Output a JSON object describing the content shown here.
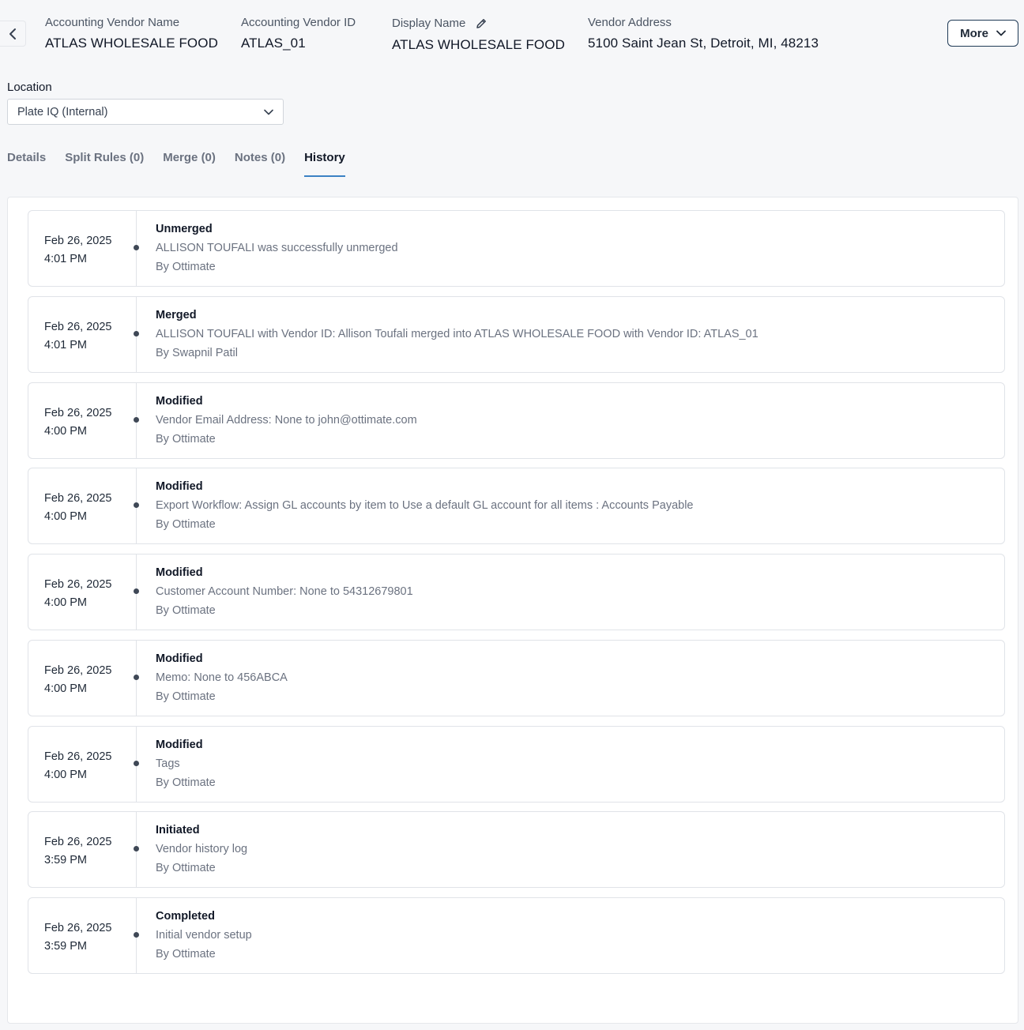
{
  "header": {
    "vendor_name_label": "Accounting Vendor Name",
    "vendor_name": "ATLAS WHOLESALE FOOD",
    "vendor_id_label": "Accounting Vendor ID",
    "vendor_id": "ATLAS_01",
    "display_name_label": "Display Name",
    "display_name": "ATLAS WHOLESALE FOOD",
    "address_label": "Vendor Address",
    "address": "5100 Saint Jean St, Detroit, MI, 48213",
    "more_label": "More"
  },
  "location": {
    "label": "Location",
    "value": "Plate IQ (Internal)"
  },
  "tabs": [
    {
      "label": "Details"
    },
    {
      "label": "Split Rules (0)"
    },
    {
      "label": "Merge (0)"
    },
    {
      "label": "Notes (0)"
    },
    {
      "label": "History"
    }
  ],
  "history": [
    {
      "date": "Feb 26, 2025",
      "time": "4:01 PM",
      "title": "Unmerged",
      "desc": "ALLISON TOUFALI was successfully unmerged",
      "by": "By Ottimate"
    },
    {
      "date": "Feb 26, 2025",
      "time": "4:01 PM",
      "title": "Merged",
      "desc": "ALLISON TOUFALI with Vendor ID: Allison Toufali merged into ATLAS WHOLESALE FOOD with Vendor ID: ATLAS_01",
      "by": "By Swapnil Patil"
    },
    {
      "date": "Feb 26, 2025",
      "time": "4:00 PM",
      "title": "Modified",
      "desc": "Vendor Email Address: None to john@ottimate.com",
      "by": "By Ottimate"
    },
    {
      "date": "Feb 26, 2025",
      "time": "4:00 PM",
      "title": "Modified",
      "desc": "Export Workflow: Assign GL accounts by item to Use a default GL account for all items : Accounts Payable",
      "by": "By Ottimate"
    },
    {
      "date": "Feb 26, 2025",
      "time": "4:00 PM",
      "title": "Modified",
      "desc": "Customer Account Number: None to 54312679801",
      "by": "By Ottimate"
    },
    {
      "date": "Feb 26, 2025",
      "time": "4:00 PM",
      "title": "Modified",
      "desc": "Memo: None to 456ABCA",
      "by": "By Ottimate"
    },
    {
      "date": "Feb 26, 2025",
      "time": "4:00 PM",
      "title": "Modified",
      "desc": "Tags",
      "by": "By Ottimate"
    },
    {
      "date": "Feb 26, 2025",
      "time": "3:59 PM",
      "title": "Initiated",
      "desc": "Vendor history log",
      "by": "By Ottimate"
    },
    {
      "date": "Feb 26, 2025",
      "time": "3:59 PM",
      "title": "Completed",
      "desc": "Initial vendor setup",
      "by": "By Ottimate"
    }
  ]
}
